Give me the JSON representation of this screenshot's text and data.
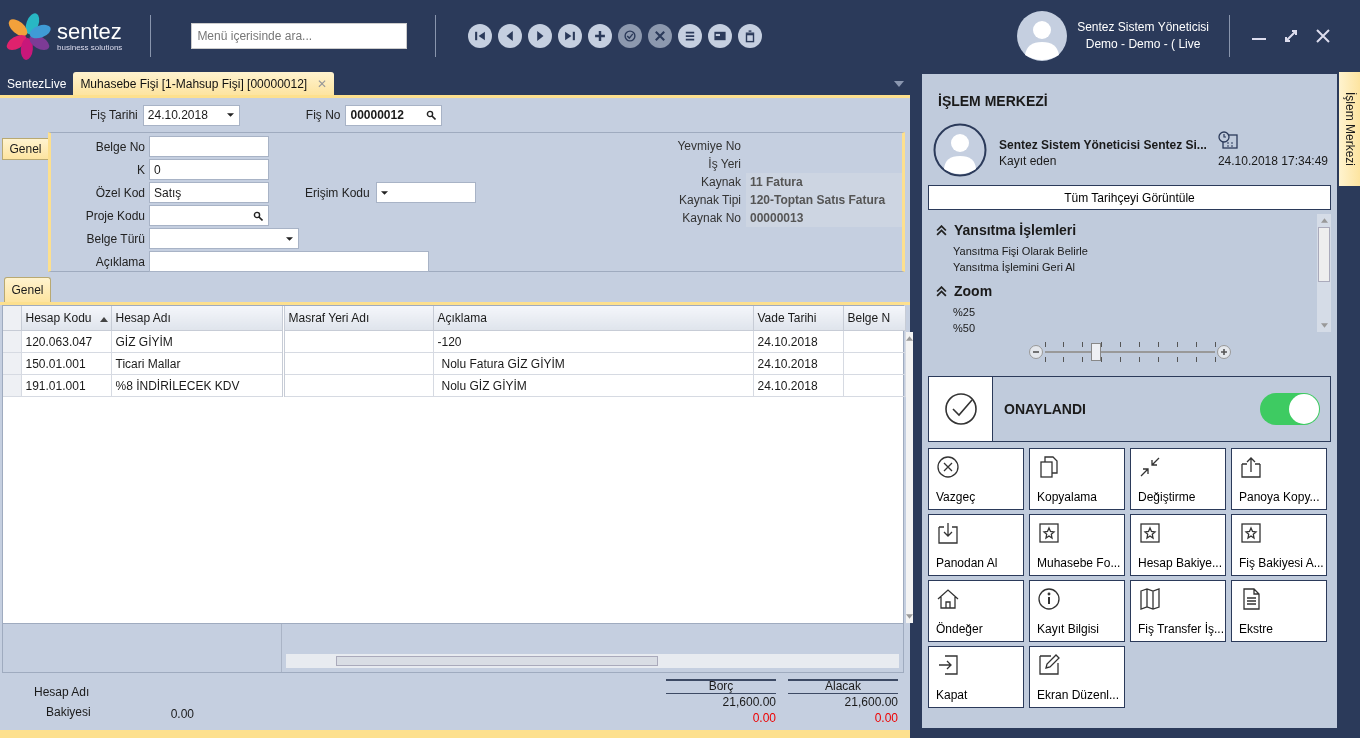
{
  "header": {
    "brand": "sentez",
    "tagline": "business solutions",
    "search": {
      "placeholder": "Menü içerisinde ara..."
    },
    "toolbar": [
      {
        "kind": "first",
        "disabled": false
      },
      {
        "kind": "prev",
        "disabled": false
      },
      {
        "kind": "next",
        "disabled": false
      },
      {
        "kind": "last",
        "disabled": false
      },
      {
        "kind": "add",
        "disabled": false
      },
      {
        "kind": "approve",
        "disabled": true
      },
      {
        "kind": "cancel",
        "disabled": true
      },
      {
        "kind": "menu",
        "disabled": false
      },
      {
        "kind": "card",
        "disabled": false
      },
      {
        "kind": "delete",
        "disabled": false
      }
    ],
    "user": {
      "name": "Sentez Sistem Yöneticisi",
      "company": "Demo - Demo - ( Live"
    }
  },
  "tabs": [
    {
      "label": "SentezLive",
      "selected": false,
      "closable": false
    },
    {
      "label": "Muhasebe Fişi [1-Mahsup Fişi]  [00000012]",
      "selected": true,
      "closable": true,
      "close": "✕"
    }
  ],
  "form": {
    "top": [
      {
        "label": "Fiş Tarihi",
        "value": "24.10.2018",
        "kind": "dropdown"
      },
      {
        "label": "Fiş No",
        "value": "00000012",
        "kind": "lookup"
      }
    ],
    "group_tab": "Genel",
    "fields": [
      {
        "label": "Belge No",
        "kind": "text"
      },
      {
        "label": "K",
        "value": "0",
        "kind": "text"
      },
      {
        "label": "Özel Kod",
        "value": "Satış",
        "kind": "text"
      },
      {
        "label": "Proje Kodu",
        "kind": "lookup"
      },
      {
        "label": "Belge Türü",
        "kind": "dropdown"
      },
      {
        "label": "Açıklama",
        "kind": "wide"
      }
    ],
    "side_field": {
      "label": "Erişim Kodu",
      "kind": "dropdown"
    },
    "info": [
      {
        "label": "Yevmiye No"
      },
      {
        "label": "İş Yeri"
      },
      {
        "label": "Kaynak",
        "value": "11  Fatura"
      },
      {
        "label": "Kaynak Tipi",
        "value": "120-Toptan Satıs Fatura"
      },
      {
        "label": "Kaynak No",
        "value": "00000013"
      }
    ]
  },
  "detail_tab": {
    "label": "Genel",
    "selected": true
  },
  "grid": {
    "columns": [
      {
        "label": "Hesap Kodu",
        "sorted": true
      },
      {
        "label": "Hesap Adı",
        "sorted": false
      },
      {
        "label": "Masraf Yeri Adı",
        "sorted": false
      },
      {
        "label": "Açıklama",
        "sorted": false
      },
      {
        "label": "Vade Tarihi",
        "sorted": false
      },
      {
        "label": "Belge N",
        "sorted": false
      }
    ],
    "rows": [
      {
        "hesap_kodu": "120.063.047",
        "hesap_adi": "GİZ GİYİM",
        "aciklama": "-120",
        "vade_tarihi": "24.10.2018"
      },
      {
        "hesap_kodu": "150.01.001",
        "hesap_adi": "Ticari Mallar",
        "aciklama": "Nolu Fatura GİZ GİYİM",
        "vade_tarihi": "24.10.2018"
      },
      {
        "hesap_kodu": "191.01.001",
        "hesap_adi": "%8 İNDİRİLECEK KDV",
        "aciklama": "Nolu GİZ GİYİM",
        "vade_tarihi": "24.10.2018"
      }
    ]
  },
  "summary": {
    "account_label": "Hesap Adı",
    "balance_label": "Bakiyesi",
    "balance": "0.00",
    "totals": [
      {
        "label": "Borç",
        "total": "21,600.00",
        "difference": "0.00"
      },
      {
        "label": "Alacak",
        "total": "21,600.00",
        "difference": "0.00"
      }
    ]
  },
  "panel": {
    "title": "İŞLEM MERKEZİ",
    "side_tab": "İşlem Merkezi",
    "recorder": {
      "name": "Sentez Sistem Yöneticisi Sentez Si...",
      "role": "Kayıt eden",
      "date": "24.10.2018 17:34:49"
    },
    "history_button": "Tüm Tarihçeyi Görüntüle",
    "sections": [
      {
        "title": "Yansıtma İşlemleri",
        "expanded": true,
        "items": [
          "Yansıtma Fişi Olarak Belirle",
          "Yansıtma İşlemini Geri Al"
        ]
      },
      {
        "title": "Zoom",
        "expanded": true,
        "items": [
          "%25",
          "%50"
        ]
      }
    ],
    "zoom": {
      "level": 0.3
    },
    "status": {
      "label": "ONAYLANDI",
      "on": true
    },
    "actions": [
      {
        "label": "Vazgeç",
        "kind": "cancel"
      },
      {
        "label": "Kopyalama",
        "kind": "copy"
      },
      {
        "label": "Değiştirme",
        "kind": "shrink"
      },
      {
        "label": "Panoya Kopy...",
        "kind": "export"
      },
      {
        "label": "Panodan Al",
        "kind": "import"
      },
      {
        "label": "Muhasebe Fo...",
        "kind": "star"
      },
      {
        "label": "Hesap Bakiye...",
        "kind": "star"
      },
      {
        "label": "Fiş Bakiyesi A...",
        "kind": "star"
      },
      {
        "label": "Öndeğer",
        "kind": "home"
      },
      {
        "label": "Kayıt Bilgisi",
        "kind": "info"
      },
      {
        "label": "Fiş Transfer İş...",
        "kind": "map"
      },
      {
        "label": "Ekstre",
        "kind": "document"
      },
      {
        "label": "Kapat",
        "kind": "exit"
      },
      {
        "label": "Ekran Düzenl...",
        "kind": "edit"
      }
    ]
  }
}
